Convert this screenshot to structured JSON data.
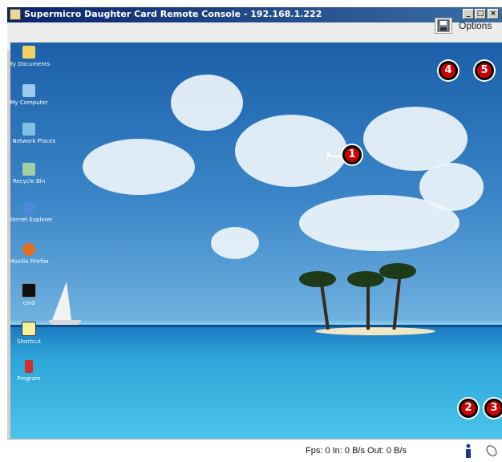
{
  "window": {
    "title": "Supermicro Daughter Card Remote Console - 192.168.1.222",
    "controls": {
      "minimize": "_",
      "maximize": "□",
      "close": "×"
    }
  },
  "toolbar": {
    "save_icon": "floppy-disk-icon",
    "options_label": "Options"
  },
  "desktop": {
    "icons": [
      {
        "name": "documents-folder-icon",
        "label": "My Documents",
        "color": "#f0d060"
      },
      {
        "name": "computer-icon",
        "label": "My Computer",
        "color": "#9ec8f0"
      },
      {
        "name": "network-icon",
        "label": "My Network Places",
        "color": "#80c0e0"
      },
      {
        "name": "recycle-bin-icon",
        "label": "Recycle Bin",
        "color": "#a0d0a0"
      },
      {
        "name": "internet-explorer-icon",
        "label": "Internet Explorer",
        "color": "#4a8ad8"
      },
      {
        "name": "firefox-icon",
        "label": "Mozilla Firefox",
        "color": "#e07020"
      },
      {
        "name": "cmd-icon",
        "label": "cmd",
        "color": "#101010"
      },
      {
        "name": "shortcut-icon",
        "label": "Shortcut",
        "color": "#f4f0a0"
      },
      {
        "name": "program-icon",
        "label": "Program",
        "color": "#d03030"
      }
    ]
  },
  "status": {
    "text": "Fps: 0 In: 0 B/s Out: 0 B/s",
    "info_icon": "info-icon",
    "mouse_icon": "mouse-icon"
  },
  "callouts": [
    "1",
    "2",
    "3",
    "4",
    "5"
  ]
}
